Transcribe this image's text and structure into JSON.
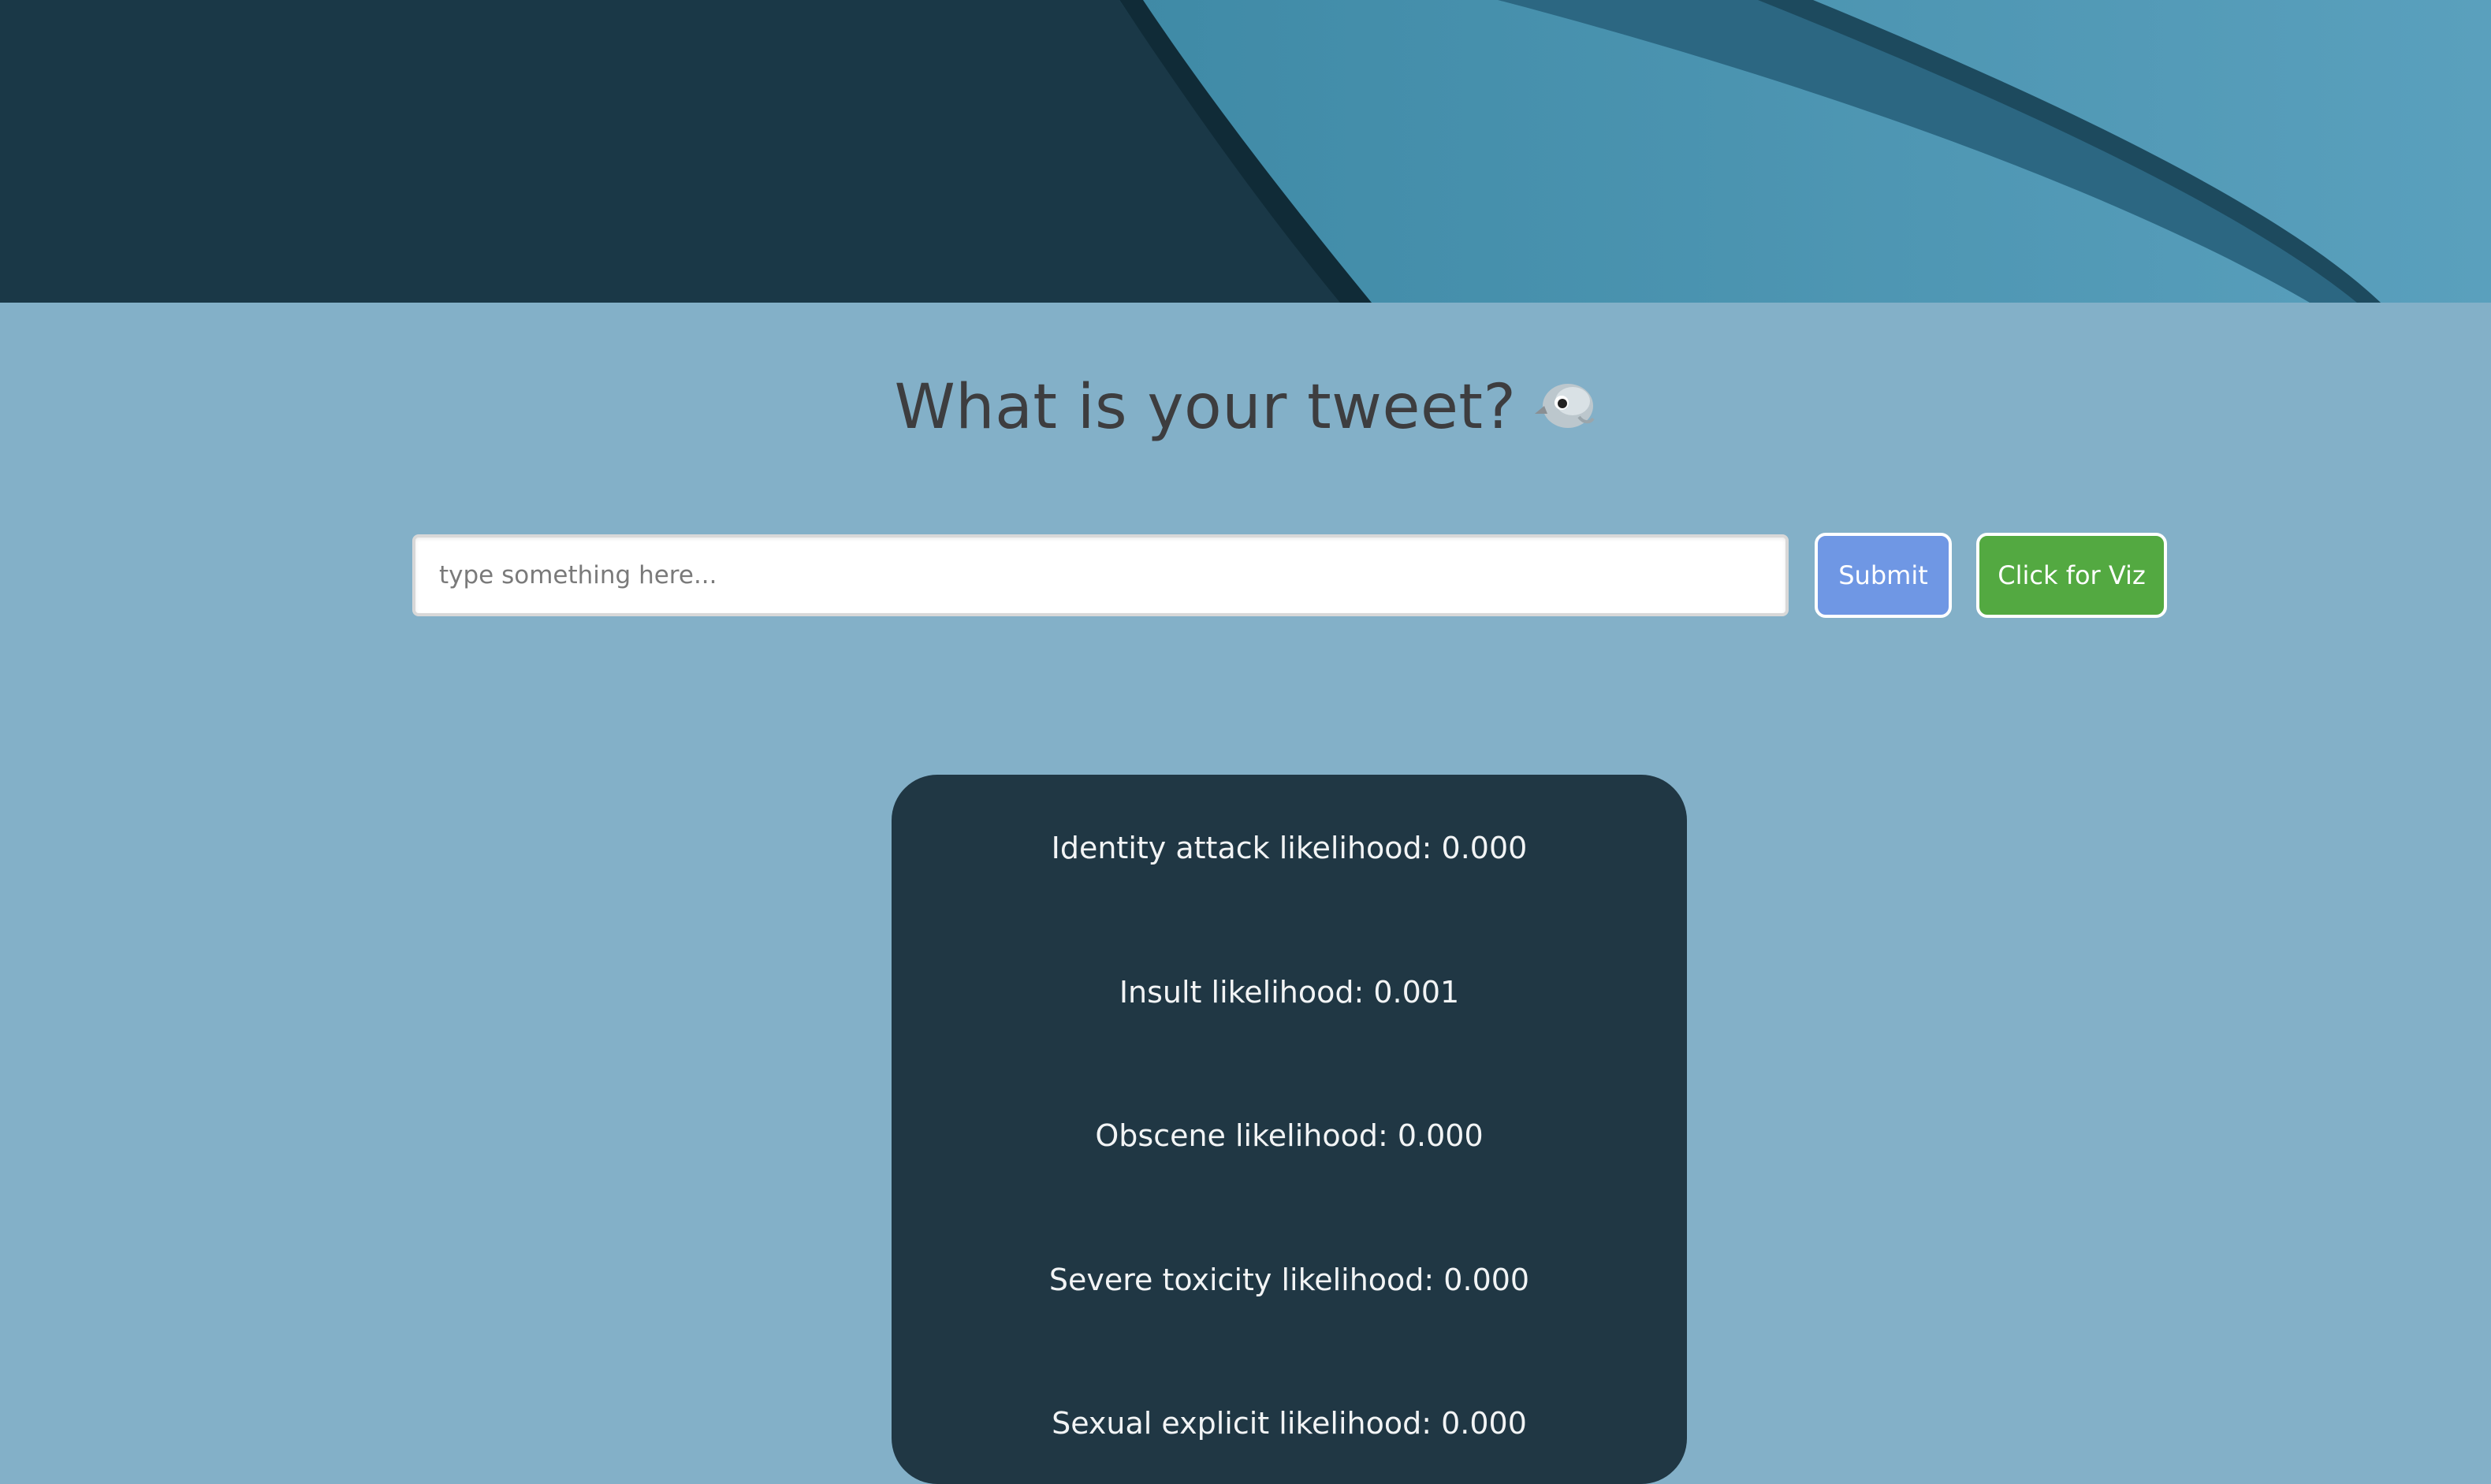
{
  "page": {
    "heading": "What is your tweet?",
    "heading_icon": "bird-icon"
  },
  "form": {
    "input_placeholder": "type something here...",
    "input_value": "",
    "submit_label": "Submit",
    "viz_label": "Click for Viz"
  },
  "results": [
    {
      "label": "Identity attack likelihood: 0.000"
    },
    {
      "label": "Insult likelihood: 0.001"
    },
    {
      "label": "Obscene likelihood: 0.000"
    },
    {
      "label": "Severe toxicity likelihood: 0.000"
    },
    {
      "label": "Sexual explicit likelihood: 0.000"
    }
  ],
  "colors": {
    "page_background": "#83b0c8",
    "card_background": "#203744",
    "submit_button": "#6f97e4",
    "viz_button": "#53a941",
    "heading_text": "#3d3d3f"
  }
}
